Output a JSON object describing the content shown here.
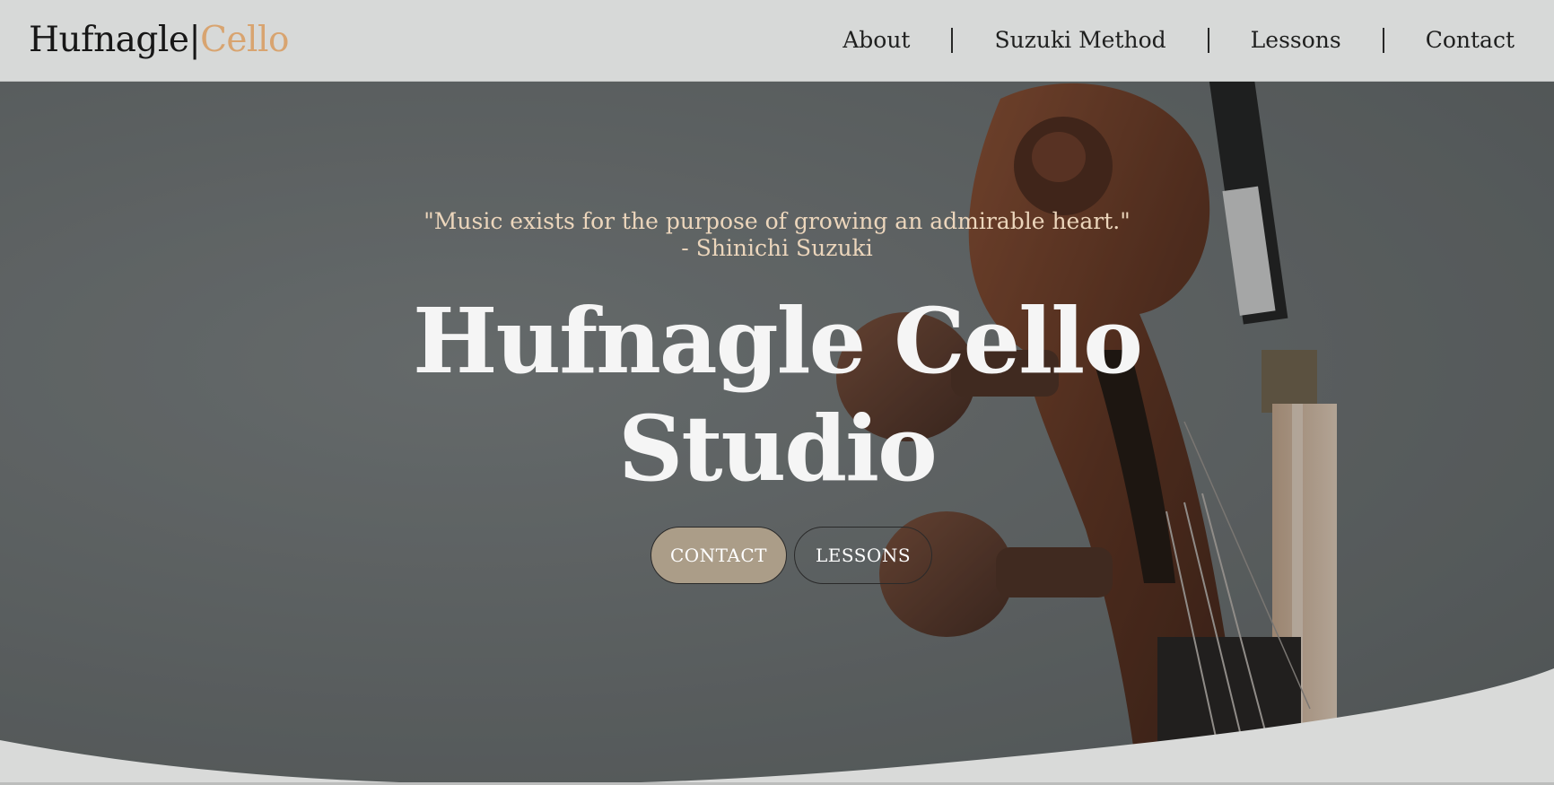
{
  "header": {
    "logo_main": "Hufnagle|",
    "logo_accent": "Cello",
    "nav": [
      {
        "label": "About"
      },
      {
        "label": "Suzuki Method"
      },
      {
        "label": "Lessons"
      },
      {
        "label": "Contact"
      }
    ]
  },
  "hero": {
    "quote": "\"Music exists for the purpose of growing an admirable heart.\"",
    "quote_author": "- Shinichi Suzuki",
    "title_line1": "Hufnagle Cello",
    "title_line2": "Studio",
    "buttons": {
      "contact": "CONTACT",
      "lessons": "LESSONS"
    },
    "background_image": "cello-scroll-photo"
  },
  "colors": {
    "accent": "#d8a36d",
    "header_bg": "#d7d9d8",
    "quote": "#ecd6bc",
    "contact_button": "#ab9d88"
  }
}
